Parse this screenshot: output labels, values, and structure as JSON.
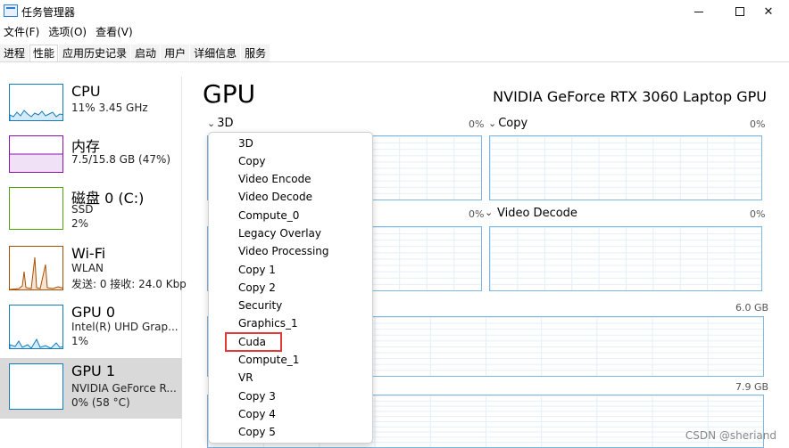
{
  "window": {
    "title": "任务管理器"
  },
  "menu": [
    "文件(F)",
    "选项(O)",
    "查看(V)"
  ],
  "tabs": [
    "进程",
    "性能",
    "应用历史记录",
    "启动",
    "用户",
    "详细信息",
    "服务"
  ],
  "sidebar": {
    "items": [
      {
        "title": "CPU",
        "lines": [
          "11%  3.45 GHz"
        ],
        "color": "#117dbb"
      },
      {
        "title": "内存",
        "lines": [
          "7.5/15.8 GB (47%)"
        ],
        "color": "#8b12ae"
      },
      {
        "title": "磁盘 0 (C:)",
        "lines": [
          "SSD",
          "2%"
        ],
        "color": "#4da60c"
      },
      {
        "title": "Wi-Fi",
        "lines": [
          "WLAN",
          "发送: 0  接收: 24.0 Kbp"
        ],
        "color": "#a74f01"
      },
      {
        "title": "GPU 0",
        "lines": [
          "Intel(R) UHD Grap...",
          "1%"
        ],
        "color": "#117dbb"
      },
      {
        "title": "GPU 1",
        "lines": [
          "NVIDIA GeForce R...",
          "0% (58 °C)"
        ],
        "color": "#117dbb"
      }
    ]
  },
  "header": {
    "title": "GPU",
    "model": "NVIDIA GeForce RTX 3060 Laptop GPU"
  },
  "panels": {
    "p1": {
      "label": "3D",
      "pct": "0%"
    },
    "p2": {
      "label": "Copy",
      "pct": "0%"
    },
    "p3": {
      "pct": "0%"
    },
    "p4": {
      "label": "Video Decode",
      "pct": "0%"
    },
    "mem1": {
      "value": "6.0 GB"
    },
    "mem2": {
      "value": "7.9 GB"
    }
  },
  "dropdown": {
    "options": [
      "3D",
      "Copy",
      "Video Encode",
      "Video Decode",
      "Compute_0",
      "Legacy Overlay",
      "Video Processing",
      "Copy 1",
      "Copy 2",
      "Security",
      "Graphics_1",
      "Cuda",
      "Compute_1",
      "VR",
      "Copy 3",
      "Copy 4",
      "Copy 5"
    ],
    "highlighted": "Cuda"
  },
  "watermark": "CSDN @sheriand"
}
